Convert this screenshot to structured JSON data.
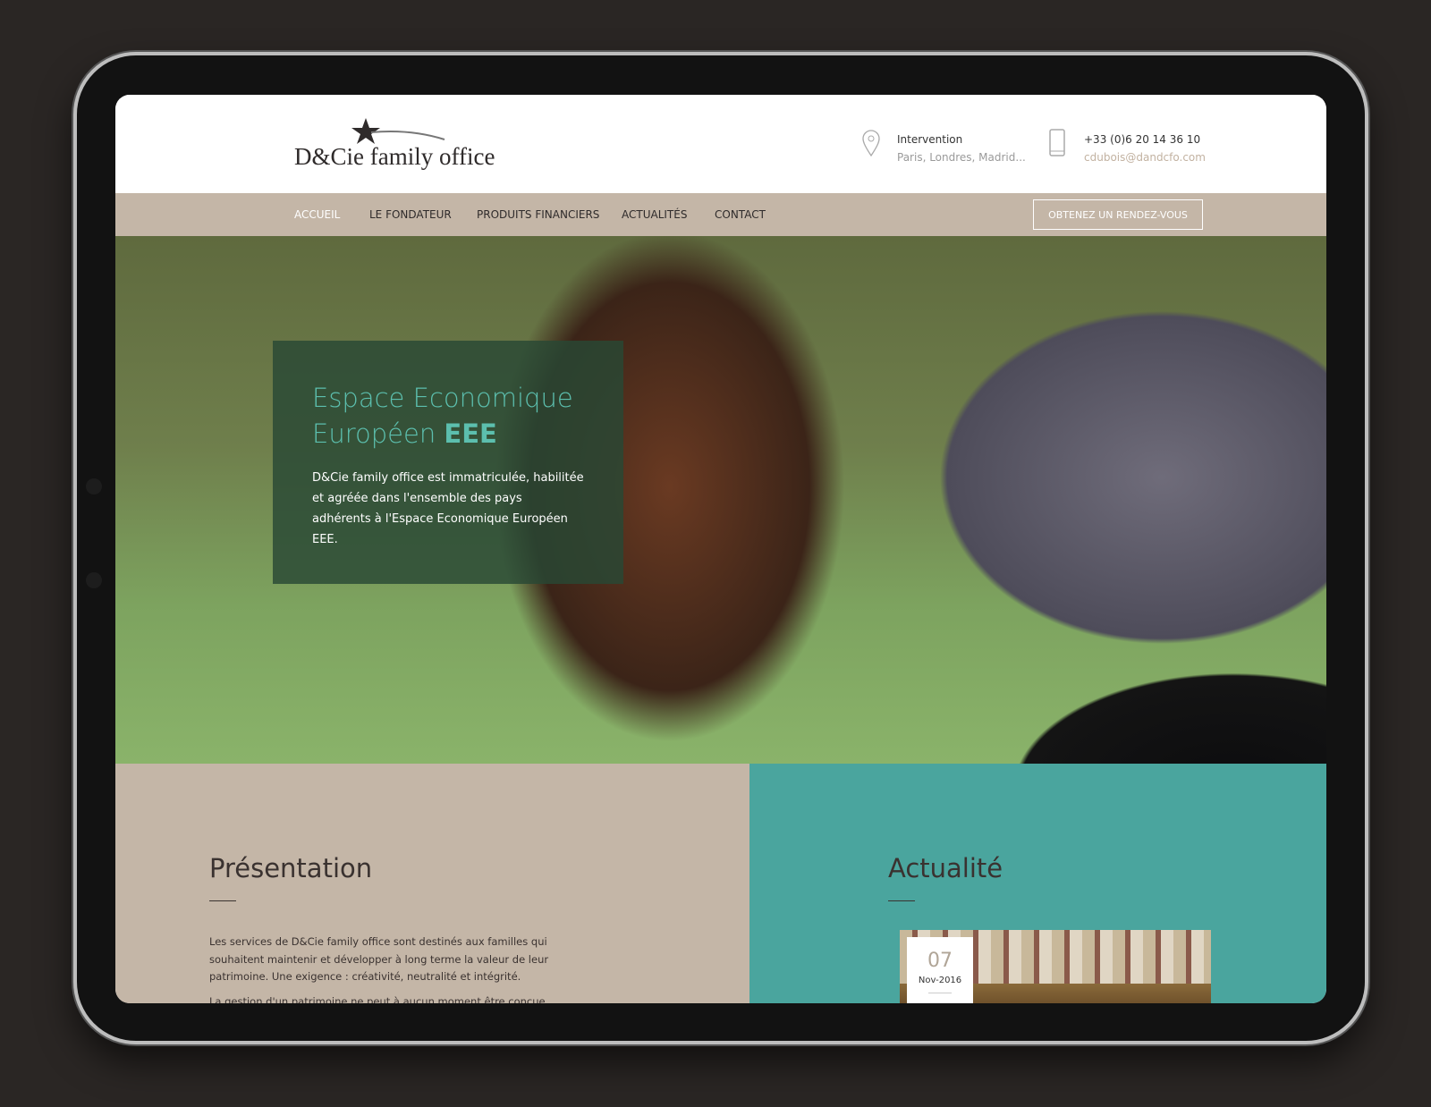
{
  "brand": {
    "logo_text": "D&Cie family office"
  },
  "header": {
    "location": {
      "icon": "map-pin-icon",
      "title": "Intervention",
      "subtitle": "Paris, Londres, Madrid..."
    },
    "contact": {
      "icon": "smartphone-icon",
      "phone": "+33 (0)6 20 14 36 10",
      "email": "cdubois@dandcfo.com"
    }
  },
  "nav": {
    "items": [
      {
        "label": "ACCUEIL",
        "active": true
      },
      {
        "label": "LE FONDATEUR"
      },
      {
        "label": "PRODUITS FINANCIERS"
      },
      {
        "label": "ACTUALITÉS"
      },
      {
        "label": "CONTACT"
      }
    ],
    "cta": "OBTENEZ UN RENDEZ-VOUS"
  },
  "hero": {
    "title_line1": "Espace Economique",
    "title_line2": "Européen",
    "title_bold": "EEE",
    "text": "D&Cie family office est immatriculée, habilitée et agréée dans l'ensemble des pays adhérents à l'Espace Economique Européen EEE."
  },
  "presentation": {
    "title": "Présentation",
    "p1": "Les services de D&Cie family office sont destinés aux familles qui souhaitent maintenir et développer à long terme la valeur de leur patrimoine. Une exigence : créativité, neutralité et intégrité.",
    "p2": "La gestion d'un patrimoine ne peut à aucun moment être conçue"
  },
  "news": {
    "title": "Actualité",
    "day": "07",
    "month": "Nov-2016"
  },
  "colors": {
    "beige": "#c4b6a7",
    "teal": "#4aa59e",
    "accent": "#5cbfae"
  }
}
